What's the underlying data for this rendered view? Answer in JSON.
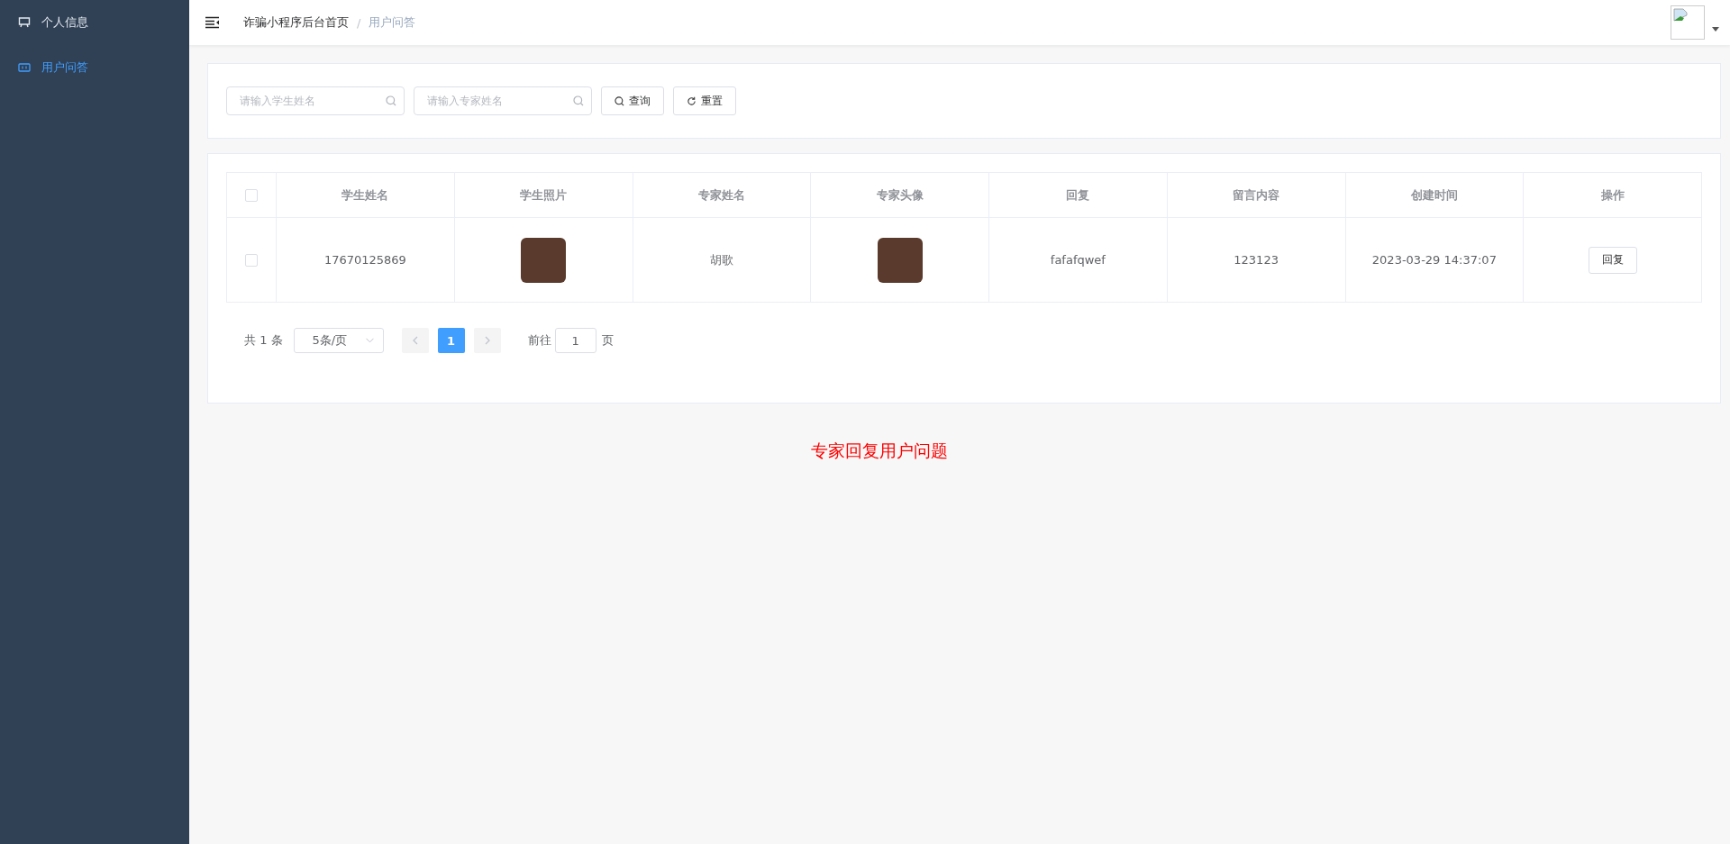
{
  "sidebar": {
    "items": [
      {
        "label": "个人信息",
        "selected": false,
        "kind": "monitor"
      },
      {
        "label": "用户问答",
        "selected": true,
        "kind": "panel"
      }
    ]
  },
  "breadcrumb": [
    "诈骗小程序后台首页",
    "用户问答"
  ],
  "breadcrumb_separator": "/",
  "search": {
    "fields": [
      {
        "placeholder": "请输入学生姓名"
      },
      {
        "placeholder": "请输入专家姓名"
      }
    ],
    "buttons": [
      {
        "label": "查询",
        "kind": "search"
      },
      {
        "label": "重置",
        "kind": "reset"
      }
    ]
  },
  "table": {
    "columns": [
      "学生姓名",
      "学生照片",
      "专家姓名",
      "专家头像",
      "回复",
      "留言内容",
      "创建时间",
      "操作"
    ],
    "rows": [
      {
        "checked": false,
        "student_name": "17670125869",
        "expert_name": "胡歌",
        "reply": "fafafqwef",
        "message": "123123",
        "created": "2023-03-29 14:37:07",
        "action": "回复"
      }
    ]
  },
  "header_checked": false,
  "pagination": {
    "total": "共 1 条",
    "page_size": "5条/页",
    "pages": [
      {
        "label": "1",
        "selected": true
      }
    ],
    "goto_label": "前往",
    "goto_value": "1",
    "goto_suffix": "页"
  },
  "caption": "专家回复用户问题"
}
